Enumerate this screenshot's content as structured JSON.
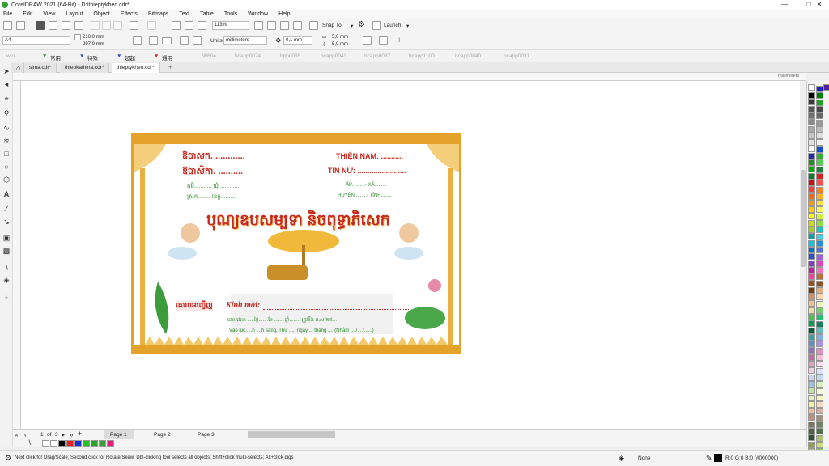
{
  "window": {
    "title": "CorelDRAW 2021 (64-Bit) - D:\\thieptykheo.cdr*"
  },
  "menu": [
    "File",
    "Edit",
    "View",
    "Layout",
    "Object",
    "Effects",
    "Bitmaps",
    "Text",
    "Table",
    "Tools",
    "Window",
    "Help"
  ],
  "standard": {
    "zoom": "113%",
    "snap": "Snap To",
    "launch": "Launch"
  },
  "property": {
    "page_size": "A4",
    "width": "210,0 mm",
    "height": "297,0 mm",
    "units_label": "Units:",
    "units": "millimeters",
    "nudge": "0,1 mm",
    "dup_x": "5,0 mm",
    "dup_y": "5,0 mm"
  },
  "custom_toolbar": [
    "wtoi",
    "常用",
    "特殊",
    "超起",
    "通用",
    "W604",
    "hcapp0074",
    "hpp0035",
    "hcapp0043",
    "hcapp0037",
    "hcapp1100",
    "hcapp0040",
    "hcapp0031"
  ],
  "tabs": [
    "sima.cdr*",
    "thiepkathina.cdr*",
    "thieptykheo.cdr*"
  ],
  "ruler_unit": "millimeters",
  "pages": {
    "current": "1",
    "of": "of",
    "total": "3",
    "labels": [
      "Page 1",
      "Page 2",
      "Page 3"
    ]
  },
  "status": {
    "hint": "Next click for Drag/Scale; Second click for Rotate/Skew; Dbl-clicking tool selects all objects; Shift+click multi-selects; Alt+click digs",
    "fill": "None",
    "color_info": "R:0 G:0 B:0 (#000000)"
  },
  "card": {
    "kh_line1": "ឱបាសក. ............",
    "kh_line2": "ឱបាសិកា. ..........",
    "kh_phum": "ភូមិ........... ឃុំ.............",
    "kh_srok": "ស្រុក........ ខេត្ត..........",
    "vn_name": "THIỆN NAM: ...........",
    "vn_nu": "TÍN NỮ: ........................",
    "vn_ap": "ẤP..........- XÃ.........",
    "vn_huyen": "HUYỆN.........- TỈNH........",
    "kh_title": "បុណ្យឧបសម្បទា និចពុទ្ធាភិសេក",
    "kh_invite": "គោរពអញ្ជើញ",
    "vn_kinh": "Kính mời:",
    "gr_line1": "ពេលវេលា .....ថ្ងៃ.......ខែ ....... ឆ្នាំ........ ត្រូវនឹង ព.ស.២៥...",
    "gr_line2": "Vào lúc.....h ....h sáng, Thứ ..... ngày ... tháng .... (Nhằm ..../..../......)"
  },
  "colors": {
    "accent": "#e5a22a",
    "red_text": "#c8281e",
    "green_text": "#2a8a2a"
  }
}
